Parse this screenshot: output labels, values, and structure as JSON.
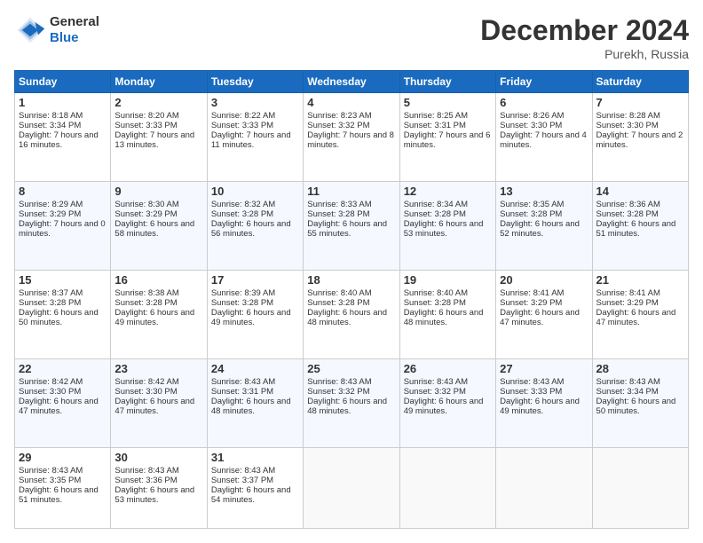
{
  "header": {
    "logo_line1": "General",
    "logo_line2": "Blue",
    "main_title": "December 2024",
    "subtitle": "Purekh, Russia"
  },
  "days_of_week": [
    "Sunday",
    "Monday",
    "Tuesday",
    "Wednesday",
    "Thursday",
    "Friday",
    "Saturday"
  ],
  "weeks": [
    [
      {
        "day": "1",
        "sunrise": "Sunrise: 8:18 AM",
        "sunset": "Sunset: 3:34 PM",
        "daylight": "Daylight: 7 hours and 16 minutes."
      },
      {
        "day": "2",
        "sunrise": "Sunrise: 8:20 AM",
        "sunset": "Sunset: 3:33 PM",
        "daylight": "Daylight: 7 hours and 13 minutes."
      },
      {
        "day": "3",
        "sunrise": "Sunrise: 8:22 AM",
        "sunset": "Sunset: 3:33 PM",
        "daylight": "Daylight: 7 hours and 11 minutes."
      },
      {
        "day": "4",
        "sunrise": "Sunrise: 8:23 AM",
        "sunset": "Sunset: 3:32 PM",
        "daylight": "Daylight: 7 hours and 8 minutes."
      },
      {
        "day": "5",
        "sunrise": "Sunrise: 8:25 AM",
        "sunset": "Sunset: 3:31 PM",
        "daylight": "Daylight: 7 hours and 6 minutes."
      },
      {
        "day": "6",
        "sunrise": "Sunrise: 8:26 AM",
        "sunset": "Sunset: 3:30 PM",
        "daylight": "Daylight: 7 hours and 4 minutes."
      },
      {
        "day": "7",
        "sunrise": "Sunrise: 8:28 AM",
        "sunset": "Sunset: 3:30 PM",
        "daylight": "Daylight: 7 hours and 2 minutes."
      }
    ],
    [
      {
        "day": "8",
        "sunrise": "Sunrise: 8:29 AM",
        "sunset": "Sunset: 3:29 PM",
        "daylight": "Daylight: 7 hours and 0 minutes."
      },
      {
        "day": "9",
        "sunrise": "Sunrise: 8:30 AM",
        "sunset": "Sunset: 3:29 PM",
        "daylight": "Daylight: 6 hours and 58 minutes."
      },
      {
        "day": "10",
        "sunrise": "Sunrise: 8:32 AM",
        "sunset": "Sunset: 3:28 PM",
        "daylight": "Daylight: 6 hours and 56 minutes."
      },
      {
        "day": "11",
        "sunrise": "Sunrise: 8:33 AM",
        "sunset": "Sunset: 3:28 PM",
        "daylight": "Daylight: 6 hours and 55 minutes."
      },
      {
        "day": "12",
        "sunrise": "Sunrise: 8:34 AM",
        "sunset": "Sunset: 3:28 PM",
        "daylight": "Daylight: 6 hours and 53 minutes."
      },
      {
        "day": "13",
        "sunrise": "Sunrise: 8:35 AM",
        "sunset": "Sunset: 3:28 PM",
        "daylight": "Daylight: 6 hours and 52 minutes."
      },
      {
        "day": "14",
        "sunrise": "Sunrise: 8:36 AM",
        "sunset": "Sunset: 3:28 PM",
        "daylight": "Daylight: 6 hours and 51 minutes."
      }
    ],
    [
      {
        "day": "15",
        "sunrise": "Sunrise: 8:37 AM",
        "sunset": "Sunset: 3:28 PM",
        "daylight": "Daylight: 6 hours and 50 minutes."
      },
      {
        "day": "16",
        "sunrise": "Sunrise: 8:38 AM",
        "sunset": "Sunset: 3:28 PM",
        "daylight": "Daylight: 6 hours and 49 minutes."
      },
      {
        "day": "17",
        "sunrise": "Sunrise: 8:39 AM",
        "sunset": "Sunset: 3:28 PM",
        "daylight": "Daylight: 6 hours and 49 minutes."
      },
      {
        "day": "18",
        "sunrise": "Sunrise: 8:40 AM",
        "sunset": "Sunset: 3:28 PM",
        "daylight": "Daylight: 6 hours and 48 minutes."
      },
      {
        "day": "19",
        "sunrise": "Sunrise: 8:40 AM",
        "sunset": "Sunset: 3:28 PM",
        "daylight": "Daylight: 6 hours and 48 minutes."
      },
      {
        "day": "20",
        "sunrise": "Sunrise: 8:41 AM",
        "sunset": "Sunset: 3:29 PM",
        "daylight": "Daylight: 6 hours and 47 minutes."
      },
      {
        "day": "21",
        "sunrise": "Sunrise: 8:41 AM",
        "sunset": "Sunset: 3:29 PM",
        "daylight": "Daylight: 6 hours and 47 minutes."
      }
    ],
    [
      {
        "day": "22",
        "sunrise": "Sunrise: 8:42 AM",
        "sunset": "Sunset: 3:30 PM",
        "daylight": "Daylight: 6 hours and 47 minutes."
      },
      {
        "day": "23",
        "sunrise": "Sunrise: 8:42 AM",
        "sunset": "Sunset: 3:30 PM",
        "daylight": "Daylight: 6 hours and 47 minutes."
      },
      {
        "day": "24",
        "sunrise": "Sunrise: 8:43 AM",
        "sunset": "Sunset: 3:31 PM",
        "daylight": "Daylight: 6 hours and 48 minutes."
      },
      {
        "day": "25",
        "sunrise": "Sunrise: 8:43 AM",
        "sunset": "Sunset: 3:32 PM",
        "daylight": "Daylight: 6 hours and 48 minutes."
      },
      {
        "day": "26",
        "sunrise": "Sunrise: 8:43 AM",
        "sunset": "Sunset: 3:32 PM",
        "daylight": "Daylight: 6 hours and 49 minutes."
      },
      {
        "day": "27",
        "sunrise": "Sunrise: 8:43 AM",
        "sunset": "Sunset: 3:33 PM",
        "daylight": "Daylight: 6 hours and 49 minutes."
      },
      {
        "day": "28",
        "sunrise": "Sunrise: 8:43 AM",
        "sunset": "Sunset: 3:34 PM",
        "daylight": "Daylight: 6 hours and 50 minutes."
      }
    ],
    [
      {
        "day": "29",
        "sunrise": "Sunrise: 8:43 AM",
        "sunset": "Sunset: 3:35 PM",
        "daylight": "Daylight: 6 hours and 51 minutes."
      },
      {
        "day": "30",
        "sunrise": "Sunrise: 8:43 AM",
        "sunset": "Sunset: 3:36 PM",
        "daylight": "Daylight: 6 hours and 53 minutes."
      },
      {
        "day": "31",
        "sunrise": "Sunrise: 8:43 AM",
        "sunset": "Sunset: 3:37 PM",
        "daylight": "Daylight: 6 hours and 54 minutes."
      },
      null,
      null,
      null,
      null
    ]
  ]
}
